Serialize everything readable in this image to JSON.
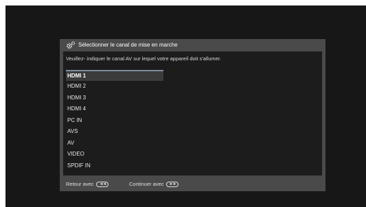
{
  "dialog": {
    "title": "Sélectionner le canal de mise en marche",
    "instruction": "Veuillez- indiquer le canal AV sur lequel votre appareil doit s'allumer.",
    "channels": [
      "HDMI 1",
      "HDMI 2",
      "HDMI 3",
      "HDMI 4",
      "PC IN",
      "AVS",
      "AV",
      "VIDEO",
      "SPDIF IN"
    ],
    "selected_index": 0
  },
  "footer": {
    "back_label": "Retour avec",
    "back_button_glyph": "◄◄",
    "continue_label": "Continuer avec",
    "continue_button_glyph": "►►"
  },
  "icons": {
    "title_icon": "gear-icon",
    "back_button_icon": "rewind-button-icon",
    "continue_button_icon": "fast-forward-button-icon"
  },
  "colors": {
    "screen_bg": "#171717",
    "dialog_bg": "#4a4a4a",
    "body_bg": "#1c1c1c",
    "selection_bar": "#7d8ea0"
  }
}
